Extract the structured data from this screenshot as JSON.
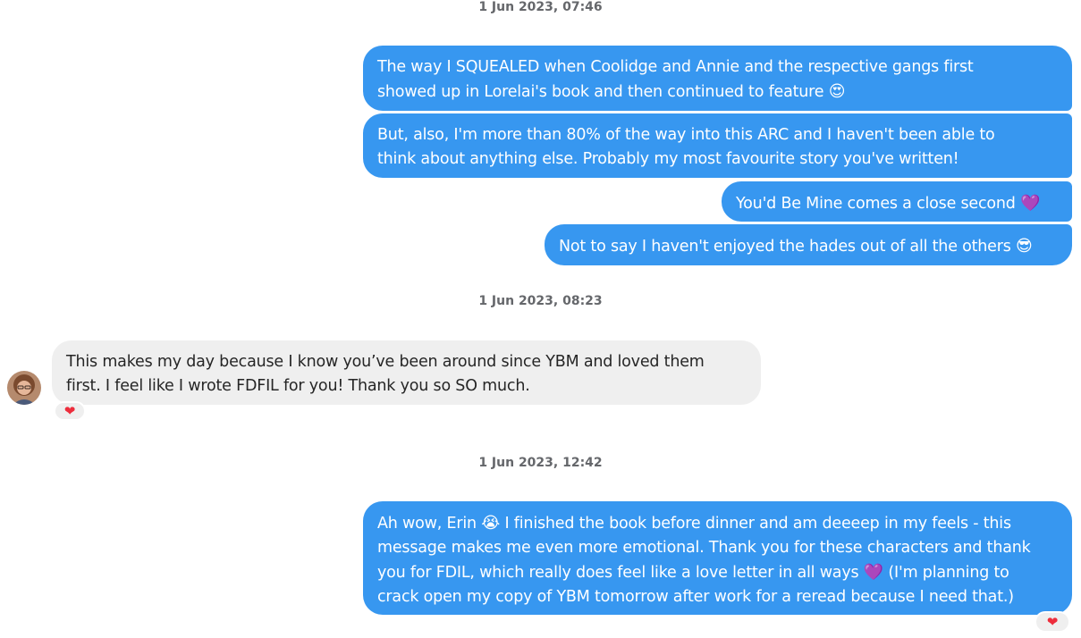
{
  "timestamps": [
    "1 Jun 2023, 07:46",
    "1 Jun 2023, 08:23",
    "1 Jun 2023, 12:42"
  ],
  "messages": {
    "m1": {
      "line1": "The way I SQUEALED when Coolidge and Annie and the respective gangs first",
      "line2": "showed up in Lorelai's book and then continued to feature",
      "emoji": "😍"
    },
    "m2": {
      "line1": "But, also, I'm more than 80% of the way into this ARC and I haven't been able to",
      "line2": "think about anything else. Probably my most favourite story you've written!"
    },
    "m3": {
      "text": "You'd Be Mine comes a close second",
      "emoji": "💜"
    },
    "m4": {
      "text": "Not to say I haven't enjoyed the hades out of all the others",
      "emoji": "😎"
    },
    "m5": {
      "line1": "This makes my day because I know you’ve been around since YBM and loved them",
      "line2": "first. I feel like I wrote FDFIL for you! Thank you so SO much."
    },
    "m6": {
      "l1a": "Ah wow, Erin",
      "l1emoji": "😭",
      "l1b": "I finished the book before dinner and am deeeep in my feels - this",
      "l2": "message makes me even more emotional. Thank you for these characters and thank",
      "l3a": "you for FDIL, which really does feel like a love letter in all ways",
      "l3emoji": "💜",
      "l3b": "(I'm planning to",
      "l4": "crack open my copy of YBM tomorrow after work for a reread because I need that.)"
    }
  },
  "reactions": {
    "incoming": "❤",
    "outgoing": "❤"
  },
  "colors": {
    "outgoing_bubble": "#3797f0",
    "incoming_bubble": "#efefef",
    "reaction_heart": "#ed2d3c"
  },
  "icons": {
    "avatar": "avatar-photo",
    "reaction": "heart-icon"
  }
}
